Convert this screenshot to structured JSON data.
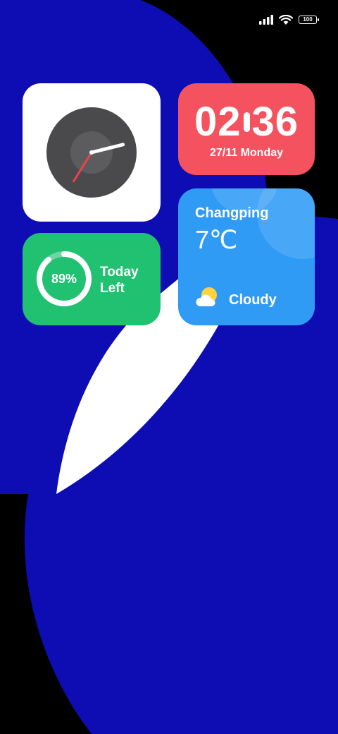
{
  "status_bar": {
    "battery_level": "100"
  },
  "widgets": {
    "clock": {
      "hour_hand_angle_deg": 212,
      "minute_hand_angle_deg": 76
    },
    "time": {
      "hours": "02",
      "minutes": "36",
      "date": "27/11 Monday"
    },
    "battery": {
      "percent_label": "89%",
      "percent_value": 89,
      "label_line1": "Today",
      "label_line2": "Left"
    },
    "weather": {
      "city": "Changping",
      "temperature": "7℃",
      "condition": "Cloudy"
    }
  },
  "colors": {
    "wallpaper_blue": "#0d0db3",
    "time_widget": "#f4525f",
    "battery_widget": "#21c172",
    "weather_widget": "#2f9bf5",
    "clock_face": "#4a4a4c",
    "clock_second_hand": "#e8434f"
  }
}
